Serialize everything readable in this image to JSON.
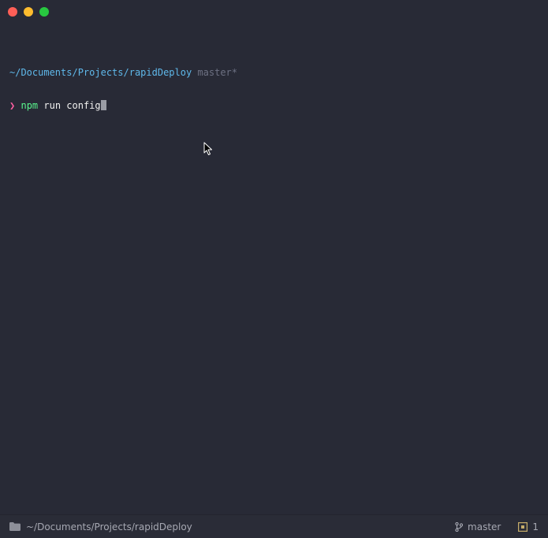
{
  "terminal": {
    "path": "~/Documents/Projects/rapidDeploy",
    "branch": "master*",
    "prompt_symbol": "❯",
    "command": "npm",
    "args": " run config"
  },
  "statusbar": {
    "cwd": "~/Documents/Projects/rapidDeploy",
    "branch": "master",
    "tab_count": "1"
  },
  "colors": {
    "background": "#282a36",
    "path": "#5fb8ea",
    "prompt": "#ff5fa2",
    "command": "#5af78e",
    "close": "#ff5f57",
    "minimize": "#febc2e",
    "zoom": "#28c840"
  },
  "icons": {
    "statusbar_folder": "folder-icon",
    "statusbar_branch": "git-branch-icon",
    "statusbar_tabs": "tab-indicator-icon",
    "pointer": "mouse-pointer-icon"
  }
}
